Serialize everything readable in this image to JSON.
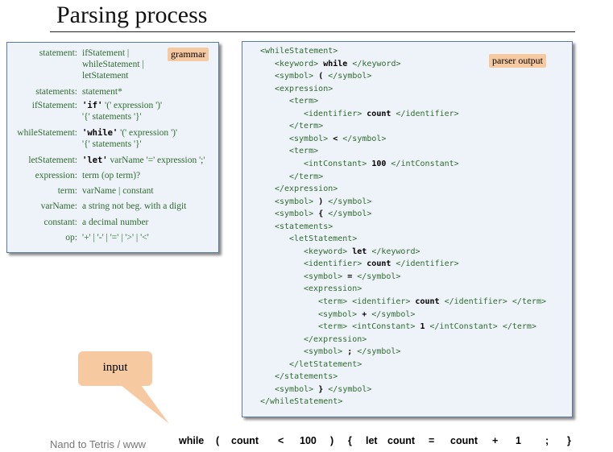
{
  "slide": {
    "title": "Parsing process",
    "footer": "Nand to Tetris / www"
  },
  "grammar": {
    "badge": "grammar",
    "rows": [
      {
        "label": "statement:",
        "lines": [
          [
            "ifStatement |"
          ],
          [
            "whileStatement |"
          ],
          [
            "letStatement"
          ]
        ]
      },
      {
        "label": "statements:",
        "lines": [
          [
            "statement*"
          ]
        ]
      },
      {
        "label": "ifStatement:",
        "lines": [
          [
            "'if'",
            " '('",
            " expression",
            " ')'"
          ],
          [
            "'{'",
            " statements",
            " '}'"
          ]
        ]
      },
      {
        "label": "whileStatement:",
        "lines": [
          [
            "'while'",
            " '('",
            " expression",
            " ')'"
          ],
          [
            "'{'",
            " statements",
            " '}'"
          ]
        ]
      },
      {
        "label": "letStatement:",
        "lines": [
          [
            "'let'",
            " varName",
            " '='",
            " expression",
            " ';'"
          ]
        ]
      },
      {
        "label": "expression:",
        "lines": [
          [
            "term (op term)?"
          ]
        ]
      },
      {
        "label": "term:",
        "lines": [
          [
            "varName | constant"
          ]
        ]
      },
      {
        "label": "varName:",
        "lines": [
          [
            "a string not beg. with a digit"
          ]
        ]
      },
      {
        "label": "constant:",
        "lines": [
          [
            "a decimal number"
          ]
        ]
      },
      {
        "label": "op:",
        "lines": [
          [
            "'+' | '-' | '=' | '>' | '<'"
          ]
        ]
      }
    ]
  },
  "parser_output": {
    "badge": "parser output",
    "lines": [
      {
        "indent": 0,
        "open": "<whileStatement>",
        "value": "",
        "close": ""
      },
      {
        "indent": 1,
        "open": "<keyword>",
        "value": "while",
        "close": "</keyword>"
      },
      {
        "indent": 1,
        "open": "<symbol>",
        "value": "(",
        "close": "</symbol>"
      },
      {
        "indent": 1,
        "open": "<expression>",
        "value": "",
        "close": ""
      },
      {
        "indent": 2,
        "open": "<term>",
        "value": "",
        "close": ""
      },
      {
        "indent": 3,
        "open": "<identifier>",
        "value": "count",
        "close": "</identifier>"
      },
      {
        "indent": 2,
        "open": "</term>",
        "value": "",
        "close": ""
      },
      {
        "indent": 2,
        "open": "<symbol>",
        "value": "<",
        "close": "</symbol>"
      },
      {
        "indent": 2,
        "open": "<term>",
        "value": "",
        "close": ""
      },
      {
        "indent": 3,
        "open": "<intConstant>",
        "value": "100",
        "close": "</intConstant>"
      },
      {
        "indent": 2,
        "open": "</term>",
        "value": "",
        "close": ""
      },
      {
        "indent": 1,
        "open": "</expression>",
        "value": "",
        "close": ""
      },
      {
        "indent": 1,
        "open": "<symbol>",
        "value": ")",
        "close": "</symbol>"
      },
      {
        "indent": 1,
        "open": "<symbol>",
        "value": "{",
        "close": "</symbol>"
      },
      {
        "indent": 1,
        "open": "<statements>",
        "value": "",
        "close": ""
      },
      {
        "indent": 2,
        "open": "<letStatement>",
        "value": "",
        "close": ""
      },
      {
        "indent": 3,
        "open": "<keyword>",
        "value": "let",
        "close": "</keyword>"
      },
      {
        "indent": 3,
        "open": "<identifier>",
        "value": "count",
        "close": "</identifier>"
      },
      {
        "indent": 3,
        "open": "<symbol>",
        "value": "=",
        "close": "</symbol>"
      },
      {
        "indent": 3,
        "open": "<expression>",
        "value": "",
        "close": ""
      },
      {
        "indent": 4,
        "open": "<term> <identifier>",
        "value": "count",
        "close": "</identifier> </term>"
      },
      {
        "indent": 4,
        "open": "<symbol>",
        "value": "+",
        "close": "</symbol>"
      },
      {
        "indent": 4,
        "open": "<term> <intConstant>",
        "value": "1",
        "close": "</intConstant> </term>"
      },
      {
        "indent": 3,
        "open": "</expression>",
        "value": "",
        "close": ""
      },
      {
        "indent": 3,
        "open": "<symbol>",
        "value": ";",
        "close": "</symbol>"
      },
      {
        "indent": 2,
        "open": "</letStatement>",
        "value": "",
        "close": ""
      },
      {
        "indent": 1,
        "open": "</statements>",
        "value": "",
        "close": ""
      },
      {
        "indent": 1,
        "open": "<symbol>",
        "value": "}",
        "close": "</symbol>"
      },
      {
        "indent": 0,
        "open": "</whileStatement>",
        "value": "",
        "close": ""
      }
    ]
  },
  "input": {
    "label": "input",
    "tokens": [
      "while",
      "(",
      "count",
      "<",
      "100",
      ")",
      "{",
      "let",
      "count",
      "=",
      "count",
      "+",
      "1",
      ";",
      "}"
    ]
  },
  "colors": {
    "panel_bg": "#eef3fa",
    "panel_border": "#5c7aa8",
    "badge_bg": "#f6c9a0",
    "grammar_text": "#2f6b2f"
  }
}
